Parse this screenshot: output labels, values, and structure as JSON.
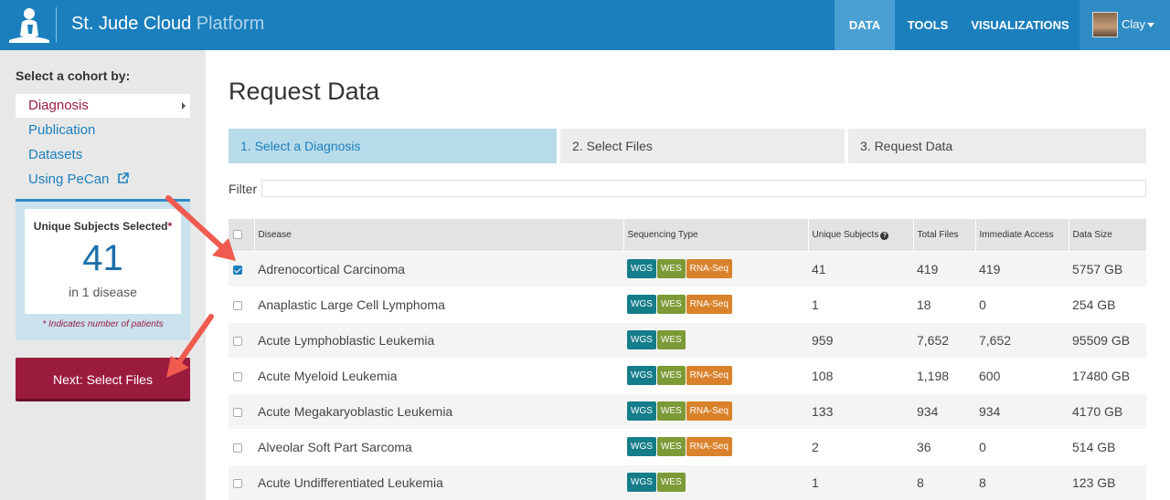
{
  "header": {
    "brand_main": "St. Jude Cloud",
    "brand_sub": "Platform",
    "nav": [
      "DATA",
      "TOOLS",
      "VISUALIZATIONS"
    ],
    "user_name": "Clay"
  },
  "sidebar": {
    "title": "Select a cohort by:",
    "items": [
      {
        "label": "Diagnosis"
      },
      {
        "label": "Publication"
      },
      {
        "label": "Datasets"
      },
      {
        "label": "Using PeCan"
      }
    ],
    "subjects_label": "Unique Subjects Selected",
    "subjects_required_mark": "*",
    "subjects_count": "41",
    "subjects_sub": "in 1 disease",
    "subjects_note": "* Indicates number of patients",
    "next_button": "Next: Select Files"
  },
  "main": {
    "title": "Request Data",
    "steps": [
      "1. Select a Diagnosis",
      "2. Select Files",
      "3. Request Data"
    ],
    "active_step": 0,
    "filter_label": "Filter",
    "filter_value": "",
    "columns": [
      "Disease",
      "Sequencing Type",
      "Unique Subjects",
      "Total Files",
      "Immediate Access",
      "Data Size"
    ],
    "rows": [
      {
        "checked": true,
        "disease": "Adrenocortical Carcinoma",
        "types": [
          "WGS",
          "WES",
          "RNA-Seq"
        ],
        "subjects": "41",
        "files": "419",
        "access": "419",
        "size": "5757 GB"
      },
      {
        "checked": false,
        "disease": "Anaplastic Large Cell Lymphoma",
        "types": [
          "WGS",
          "WES",
          "RNA-Seq"
        ],
        "subjects": "1",
        "files": "18",
        "access": "0",
        "size": "254 GB"
      },
      {
        "checked": false,
        "disease": "Acute Lymphoblastic Leukemia",
        "types": [
          "WGS",
          "WES"
        ],
        "subjects": "959",
        "files": "7,652",
        "access": "7,652",
        "size": "95509 GB"
      },
      {
        "checked": false,
        "disease": "Acute Myeloid Leukemia",
        "types": [
          "WGS",
          "WES",
          "RNA-Seq"
        ],
        "subjects": "108",
        "files": "1,198",
        "access": "600",
        "size": "17480 GB"
      },
      {
        "checked": false,
        "disease": "Acute Megakaryoblastic Leukemia",
        "types": [
          "WGS",
          "WES",
          "RNA-Seq"
        ],
        "subjects": "133",
        "files": "934",
        "access": "934",
        "size": "4170 GB"
      },
      {
        "checked": false,
        "disease": "Alveolar Soft Part Sarcoma",
        "types": [
          "WGS",
          "WES",
          "RNA-Seq"
        ],
        "subjects": "2",
        "files": "36",
        "access": "0",
        "size": "514 GB"
      },
      {
        "checked": false,
        "disease": "Acute Undifferentiated Leukemia",
        "types": [
          "WGS",
          "WES"
        ],
        "subjects": "1",
        "files": "8",
        "access": "8",
        "size": "123 GB"
      }
    ]
  },
  "colors": {
    "nav_blue": "#1b7fbd",
    "accent_red": "#9b1b3f",
    "wgs": "#157d8a",
    "wes": "#7c9a36",
    "rna": "#d9822b",
    "arrow": "#f05a4f"
  }
}
